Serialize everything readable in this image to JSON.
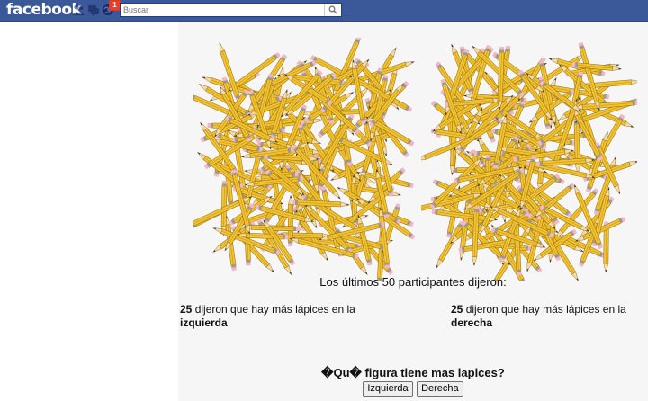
{
  "topbar": {
    "logo": "facebook",
    "icons": [
      "friend-requests-icon",
      "messages-icon",
      "notifications-icon"
    ],
    "notification_count": "1",
    "search_placeholder": "Buscar",
    "brand_color": "#3b5998"
  },
  "app": {
    "summary": "Los últimos 50 participantes dijeron:",
    "left_result": {
      "count": "25",
      "text": " dijeron que hay más lápices en la ",
      "side": "izquierda"
    },
    "right_result": {
      "count": "25",
      "text": " dijeron que hay más lápices en la ",
      "side": "derecha"
    },
    "question": "�Qu� figura tiene mas lapices?",
    "buttons": {
      "left": "Izquierda",
      "right": "Derecha"
    },
    "pencil_colors": {
      "body": "#f2c230",
      "wood": "#f6d9a8",
      "tip": "#333333",
      "eraser": "#f4b6c2",
      "band": "#9a9a9a"
    }
  }
}
